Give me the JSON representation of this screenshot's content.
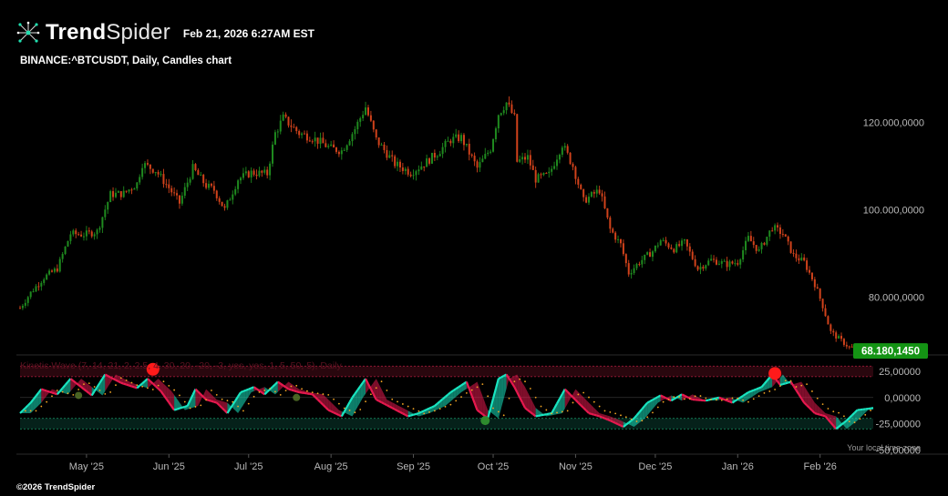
{
  "header": {
    "brand_bold": "Trend",
    "brand_light": "Spider",
    "timestamp": "Feb 21, 2026 6:27AM EST"
  },
  "symbol_line": "BINANCE:^BTCUSDT, Daily, Candles chart",
  "indicator_label": "Kinetic Wave (7, 14, 21, 2, 2.5, 4, 30, 20, -20, -3, yes, yes, 1, 5, 50, 5), Daily",
  "last_price_label": "68.180,1450",
  "time_zone_note": "Your local time zone",
  "footer": "©2026 TrendSpider",
  "colors": {
    "up": "#1f8a1f",
    "down": "#d0421b",
    "wave_up": "#19e6c1",
    "wave_down": "#e8194f",
    "dots": "#f5a623",
    "signal": "#ff1a1a",
    "price_badge": "#149414"
  },
  "chart_data": {
    "type": "candlestick",
    "title": "BINANCE:^BTCUSDT, Daily, Candles chart",
    "price_axis": {
      "ticks": [
        80000,
        100000,
        120000
      ],
      "tick_labels": [
        "80.000,0000",
        "100.000,0000",
        "120.000,0000"
      ],
      "ylim": [
        68000,
        125500
      ]
    },
    "x_axis": {
      "tick_labels": [
        "May '25",
        "Jun '25",
        "Jul '25",
        "Aug '25",
        "Sep '25",
        "Oct '25",
        "Nov '25",
        "Dec '25",
        "Jan '26",
        "Feb '26"
      ],
      "tick_dates": [
        "2025-05-01",
        "2025-06-01",
        "2025-07-01",
        "2025-08-01",
        "2025-09-01",
        "2025-10-01",
        "2025-11-01",
        "2025-12-01",
        "2026-01-01",
        "2026-02-01"
      ],
      "range": [
        "2025-04-06",
        "2026-02-21"
      ]
    },
    "close_series": [
      [
        "2025-04-06",
        77500
      ],
      [
        "2025-04-10",
        81000
      ],
      [
        "2025-04-15",
        84500
      ],
      [
        "2025-04-20",
        86500
      ],
      [
        "2025-04-25",
        94500
      ],
      [
        "2025-04-30",
        94300
      ],
      [
        "2025-05-05",
        95000
      ],
      [
        "2025-05-10",
        103500
      ],
      [
        "2025-05-15",
        103700
      ],
      [
        "2025-05-20",
        106000
      ],
      [
        "2025-05-22",
        110500
      ],
      [
        "2025-05-27",
        109000
      ],
      [
        "2025-06-01",
        105000
      ],
      [
        "2025-06-05",
        101500
      ],
      [
        "2025-06-10",
        109500
      ],
      [
        "2025-06-15",
        105500
      ],
      [
        "2025-06-18",
        104500
      ],
      [
        "2025-06-22",
        100000
      ],
      [
        "2025-06-27",
        107000
      ],
      [
        "2025-07-02",
        108500
      ],
      [
        "2025-07-08",
        108200
      ],
      [
        "2025-07-11",
        117500
      ],
      [
        "2025-07-14",
        121000
      ],
      [
        "2025-07-20",
        117500
      ],
      [
        "2025-07-25",
        116500
      ],
      [
        "2025-08-01",
        114000
      ],
      [
        "2025-08-05",
        113500
      ],
      [
        "2025-08-10",
        118500
      ],
      [
        "2025-08-14",
        123500
      ],
      [
        "2025-08-18",
        116000
      ],
      [
        "2025-08-25",
        110500
      ],
      [
        "2025-08-31",
        108500
      ],
      [
        "2025-09-05",
        110500
      ],
      [
        "2025-09-10",
        113000
      ],
      [
        "2025-09-15",
        116000
      ],
      [
        "2025-09-19",
        116500
      ],
      [
        "2025-09-25",
        109500
      ],
      [
        "2025-09-30",
        114000
      ],
      [
        "2025-10-03",
        122000
      ],
      [
        "2025-10-06",
        124500
      ],
      [
        "2025-10-09",
        121000
      ],
      [
        "2025-10-10",
        111000
      ],
      [
        "2025-10-14",
        112000
      ],
      [
        "2025-10-17",
        107000
      ],
      [
        "2025-10-22",
        108000
      ],
      [
        "2025-10-27",
        115000
      ],
      [
        "2025-10-31",
        110000
      ],
      [
        "2025-11-04",
        102000
      ],
      [
        "2025-11-10",
        104500
      ],
      [
        "2025-11-14",
        95500
      ],
      [
        "2025-11-18",
        92000
      ],
      [
        "2025-11-21",
        85500
      ],
      [
        "2025-11-25",
        88000
      ],
      [
        "2025-11-30",
        90500
      ],
      [
        "2025-12-03",
        93000
      ],
      [
        "2025-12-08",
        91000
      ],
      [
        "2025-12-12",
        92500
      ],
      [
        "2025-12-17",
        86500
      ],
      [
        "2025-12-22",
        88500
      ],
      [
        "2025-12-28",
        87500
      ],
      [
        "2026-01-01",
        88000
      ],
      [
        "2026-01-05",
        93500
      ],
      [
        "2026-01-09",
        90500
      ],
      [
        "2026-01-14",
        96000
      ],
      [
        "2026-01-18",
        94500
      ],
      [
        "2026-01-22",
        89500
      ],
      [
        "2026-01-26",
        88000
      ],
      [
        "2026-01-30",
        83000
      ],
      [
        "2026-02-02",
        78000
      ],
      [
        "2026-02-05",
        72000
      ],
      [
        "2026-02-08",
        70500
      ],
      [
        "2026-02-12",
        68500
      ],
      [
        "2026-02-16",
        68000
      ],
      [
        "2026-02-21",
        68180
      ]
    ],
    "last_price": 68180.145,
    "indicator": {
      "name": "Kinetic Wave",
      "ticks": [
        25,
        0,
        -25,
        -50
      ],
      "tick_labels": [
        "25,00000",
        "0,00000",
        "-25,00000",
        "-50,00000"
      ],
      "ylim": [
        -55,
        32
      ],
      "overbought": 20,
      "oversold": -20,
      "wave": [
        [
          "2025-04-06",
          -15
        ],
        [
          "2025-04-10",
          -5
        ],
        [
          "2025-04-14",
          8
        ],
        [
          "2025-04-20",
          3
        ],
        [
          "2025-04-25",
          18
        ],
        [
          "2025-04-29",
          10
        ],
        [
          "2025-05-03",
          2
        ],
        [
          "2025-05-08",
          22
        ],
        [
          "2025-05-14",
          14
        ],
        [
          "2025-05-20",
          9
        ],
        [
          "2025-05-24",
          18
        ],
        [
          "2025-05-29",
          6
        ],
        [
          "2025-06-03",
          -12
        ],
        [
          "2025-06-08",
          -8
        ],
        [
          "2025-06-11",
          8
        ],
        [
          "2025-06-15",
          -2
        ],
        [
          "2025-06-19",
          -5
        ],
        [
          "2025-06-23",
          -15
        ],
        [
          "2025-06-28",
          5
        ],
        [
          "2025-07-03",
          10
        ],
        [
          "2025-07-07",
          3
        ],
        [
          "2025-07-12",
          15
        ],
        [
          "2025-07-16",
          8
        ],
        [
          "2025-07-20",
          5
        ],
        [
          "2025-07-25",
          3
        ],
        [
          "2025-07-31",
          -12
        ],
        [
          "2025-08-05",
          -18
        ],
        [
          "2025-08-09",
          0
        ],
        [
          "2025-08-14",
          18
        ],
        [
          "2025-08-18",
          -2
        ],
        [
          "2025-08-24",
          -10
        ],
        [
          "2025-08-30",
          -18
        ],
        [
          "2025-09-03",
          -15
        ],
        [
          "2025-09-09",
          -8
        ],
        [
          "2025-09-15",
          5
        ],
        [
          "2025-09-21",
          15
        ],
        [
          "2025-09-25",
          -12
        ],
        [
          "2025-09-29",
          -20
        ],
        [
          "2025-10-03",
          18
        ],
        [
          "2025-10-06",
          22
        ],
        [
          "2025-10-09",
          10
        ],
        [
          "2025-10-13",
          -10
        ],
        [
          "2025-10-17",
          -18
        ],
        [
          "2025-10-23",
          -15
        ],
        [
          "2025-10-28",
          8
        ],
        [
          "2025-11-02",
          -5
        ],
        [
          "2025-11-06",
          -15
        ],
        [
          "2025-11-10",
          -18
        ],
        [
          "2025-11-14",
          -22
        ],
        [
          "2025-11-19",
          -28
        ],
        [
          "2025-11-23",
          -20
        ],
        [
          "2025-11-28",
          -5
        ],
        [
          "2025-12-03",
          2
        ],
        [
          "2025-12-07",
          -3
        ],
        [
          "2025-12-11",
          3
        ],
        [
          "2025-12-15",
          -2
        ],
        [
          "2025-12-20",
          -3
        ],
        [
          "2025-12-25",
          0
        ],
        [
          "2025-12-30",
          -5
        ],
        [
          "2026-01-05",
          5
        ],
        [
          "2026-01-10",
          10
        ],
        [
          "2026-01-14",
          22
        ],
        [
          "2026-01-17",
          12
        ],
        [
          "2026-01-21",
          15
        ],
        [
          "2026-01-26",
          -5
        ],
        [
          "2026-01-30",
          -15
        ],
        [
          "2026-02-03",
          -18
        ],
        [
          "2026-02-07",
          -30
        ],
        [
          "2026-02-11",
          -22
        ],
        [
          "2026-02-15",
          -12
        ],
        [
          "2026-02-21",
          -10
        ]
      ],
      "signals": [
        {
          "date": "2025-05-26",
          "value": 27,
          "kind": "bearish"
        },
        {
          "date": "2026-01-15",
          "value": 23,
          "kind": "bearish"
        },
        {
          "date": "2025-04-28",
          "value": 2,
          "kind": "minor"
        },
        {
          "date": "2025-07-19",
          "value": 0,
          "kind": "minor"
        },
        {
          "date": "2025-09-28",
          "value": -22,
          "kind": "bullish"
        }
      ]
    }
  }
}
